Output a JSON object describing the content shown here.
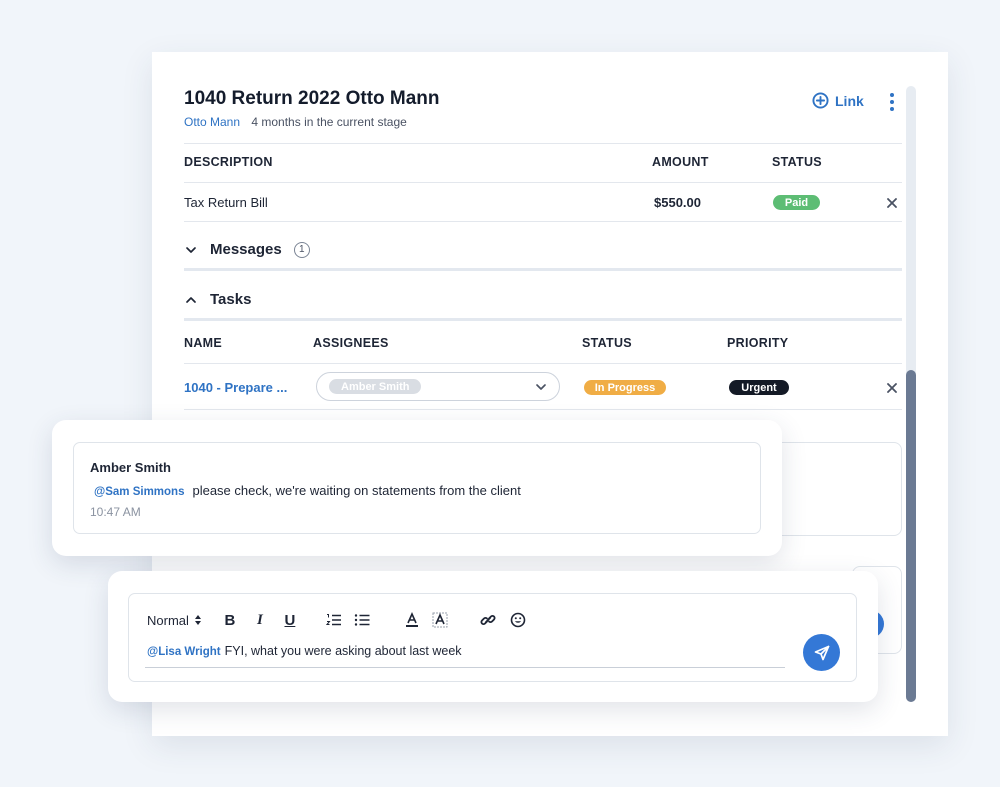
{
  "card": {
    "title": "1040 Return 2022 Otto Mann",
    "client_name": "Otto Mann",
    "stage_text": "4 months in the current stage",
    "link_label": "Link"
  },
  "billing": {
    "headers": {
      "description": "DESCRIPTION",
      "amount": "AMOUNT",
      "status": "STATUS"
    },
    "rows": [
      {
        "description": "Tax Return Bill",
        "amount": "$550.00",
        "status": "Paid"
      }
    ]
  },
  "messages": {
    "label": "Messages",
    "count": "1"
  },
  "tasks": {
    "label": "Tasks",
    "headers": {
      "name": "NAME",
      "assignees": "ASSIGNEES",
      "status": "STATUS",
      "priority": "PRIORITY"
    },
    "rows": [
      {
        "name": "1040 - Prepare ...",
        "assignee": "Amber Smith",
        "status": "In Progress",
        "priority": "Urgent"
      }
    ]
  },
  "message_popup": {
    "author": "Amber Smith",
    "mention": "@Sam Simmons",
    "text": "please check, we're waiting on statements from the client",
    "time": "10:47 AM"
  },
  "composer": {
    "text_size": "Normal",
    "bold": "B",
    "italic": "I",
    "underline": "U",
    "mention": "@Lisa Wright",
    "text": "FYI, what you were asking about last week"
  },
  "colors": {
    "accent": "#2f73c4",
    "send_button": "#3478d6",
    "paid": "#5dbd74",
    "in_progress": "#f0ad45",
    "urgent": "#141a26",
    "page_background": "#f1f5fa"
  }
}
